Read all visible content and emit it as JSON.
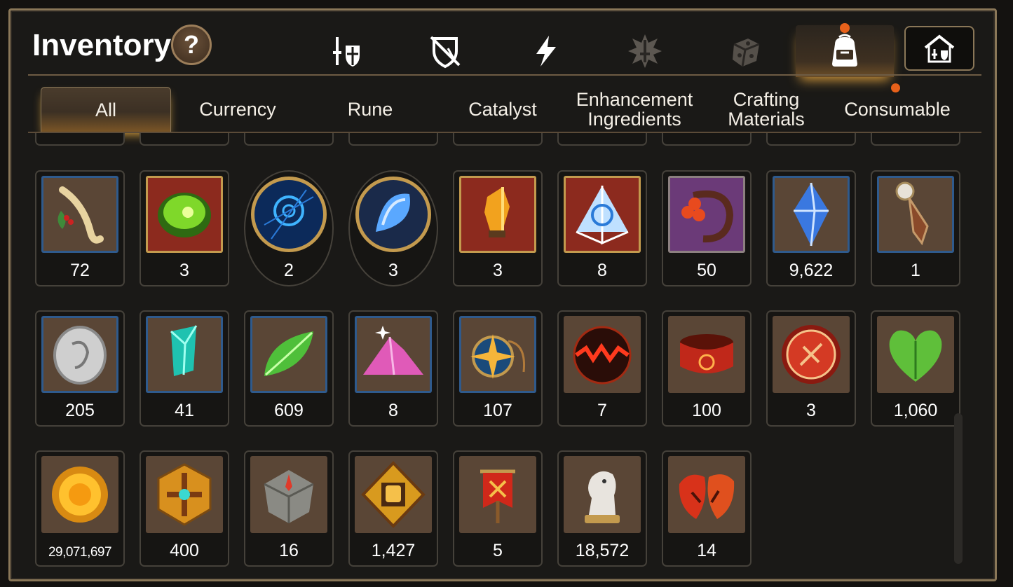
{
  "header": {
    "title": "Inventory",
    "help_label": "?"
  },
  "top_tabs": [
    {
      "icon": "sword-shield-icon"
    },
    {
      "icon": "broken-shield-icon"
    },
    {
      "icon": "lightning-icon"
    },
    {
      "icon": "sword-splash-icon"
    },
    {
      "icon": "dice-icon"
    },
    {
      "icon": "backpack-icon",
      "active": true,
      "notification": true
    },
    {
      "icon": "house-armory-icon"
    }
  ],
  "subtabs": [
    {
      "label": "All",
      "active": true
    },
    {
      "label": "Currency"
    },
    {
      "label": "Rune"
    },
    {
      "label": "Catalyst"
    },
    {
      "label": "Enhancement Ingredients"
    },
    {
      "label": "Crafting Materials"
    },
    {
      "label": "Consumable",
      "notification": true
    }
  ],
  "colors": {
    "accent_gold": "#d9a240",
    "notification": "#e8611a",
    "blue_frame": "#3c6fa8",
    "gold_frame": "#c39a4e",
    "purple_bg": "#6b3a78"
  },
  "items": [
    {
      "icon": "ginseng-root-icon",
      "count": "72"
    },
    {
      "icon": "green-orb-icon",
      "count": "3"
    },
    {
      "icon": "blue-rune-circle-icon",
      "count": "2"
    },
    {
      "icon": "blue-crystal-shard-icon",
      "count": "3"
    },
    {
      "icon": "amber-crystal-icon",
      "count": "3"
    },
    {
      "icon": "triquetra-crystal-icon",
      "count": "8"
    },
    {
      "icon": "flower-ring-icon",
      "count": "50"
    },
    {
      "icon": "blue-gem-icon",
      "count": "9,622"
    },
    {
      "icon": "pendant-icon",
      "count": "1"
    },
    {
      "icon": "silver-coin-icon",
      "count": "205"
    },
    {
      "icon": "teal-crystal-icon",
      "count": "41"
    },
    {
      "icon": "green-leaf-icon",
      "count": "609"
    },
    {
      "icon": "pink-sand-icon",
      "count": "8"
    },
    {
      "icon": "compass-star-icon",
      "count": "107"
    },
    {
      "icon": "lava-orb-icon",
      "count": "7"
    },
    {
      "icon": "red-bracelet-icon",
      "count": "100"
    },
    {
      "icon": "red-badge-icon",
      "count": "3"
    },
    {
      "icon": "green-heart-icon",
      "count": "1,060"
    },
    {
      "icon": "gold-coin-icon",
      "count": "29,071,697"
    },
    {
      "icon": "gold-emblem-icon",
      "count": "400"
    },
    {
      "icon": "stone-compass-icon",
      "count": "16"
    },
    {
      "icon": "fist-medal-icon",
      "count": "1,427"
    },
    {
      "icon": "red-banner-icon",
      "count": "5"
    },
    {
      "icon": "chess-knight-icon",
      "count": "18,572"
    },
    {
      "icon": "red-leaves-icon",
      "count": "14"
    }
  ]
}
